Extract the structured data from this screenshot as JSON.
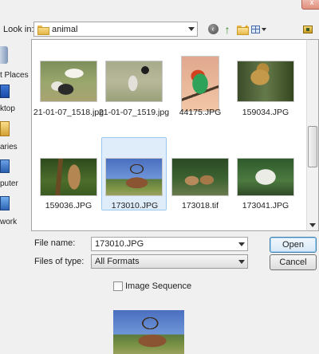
{
  "toolbar": {
    "look_in_label": "Look in:",
    "look_in_value": "animal",
    "close_glyph": "x",
    "back_glyph": "‹",
    "up_glyph": "↑",
    "new_folder_glyph": "✦",
    "icons": [
      "back-icon",
      "up-folder-icon",
      "new-folder-icon",
      "view-menu-icon",
      "desktop-icon"
    ]
  },
  "places": {
    "recent": "t Places",
    "desktop": "ktop",
    "libraries": "aries",
    "computer": "puter",
    "network": "work"
  },
  "files": [
    {
      "name": "21-01-07_1518.jpg",
      "selected": false
    },
    {
      "name": "21-01-07_1519.jpg",
      "selected": false
    },
    {
      "name": "44175.JPG",
      "selected": false
    },
    {
      "name": "159034.JPG",
      "selected": false
    },
    {
      "name": "159036.JPG",
      "selected": false
    },
    {
      "name": "173010.JPG",
      "selected": true
    },
    {
      "name": "173018.tif",
      "selected": false
    },
    {
      "name": "173041.JPG",
      "selected": false
    }
  ],
  "form": {
    "file_name_label": "File name:",
    "file_name_value": "173010.JPG",
    "files_of_type_label": "Files of type:",
    "files_of_type_value": "All Formats",
    "open_label": "Open",
    "cancel_label": "Cancel",
    "image_sequence_label": "Image Sequence",
    "image_sequence_checked": false
  },
  "colors": {
    "selection_fill": "#dfedfb",
    "selection_border": "#99c8f0",
    "default_button_border": "#3c7fb1"
  }
}
